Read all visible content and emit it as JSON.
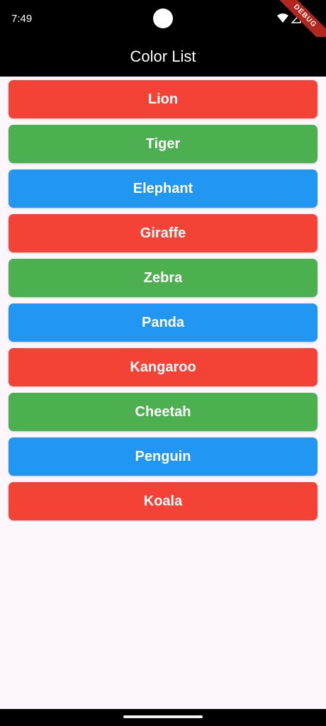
{
  "status": {
    "time": "7:49",
    "debug": "DEBUG"
  },
  "app_bar": {
    "title": "Color List"
  },
  "colors": {
    "red": "#f44336",
    "green": "#4caf50",
    "blue": "#2196f3"
  },
  "items": [
    {
      "label": "Lion",
      "color": "#f44336"
    },
    {
      "label": "Tiger",
      "color": "#4caf50"
    },
    {
      "label": "Elephant",
      "color": "#2196f3"
    },
    {
      "label": "Giraffe",
      "color": "#f44336"
    },
    {
      "label": "Zebra",
      "color": "#4caf50"
    },
    {
      "label": "Panda",
      "color": "#2196f3"
    },
    {
      "label": "Kangaroo",
      "color": "#f44336"
    },
    {
      "label": "Cheetah",
      "color": "#4caf50"
    },
    {
      "label": "Penguin",
      "color": "#2196f3"
    },
    {
      "label": "Koala",
      "color": "#f44336"
    }
  ]
}
